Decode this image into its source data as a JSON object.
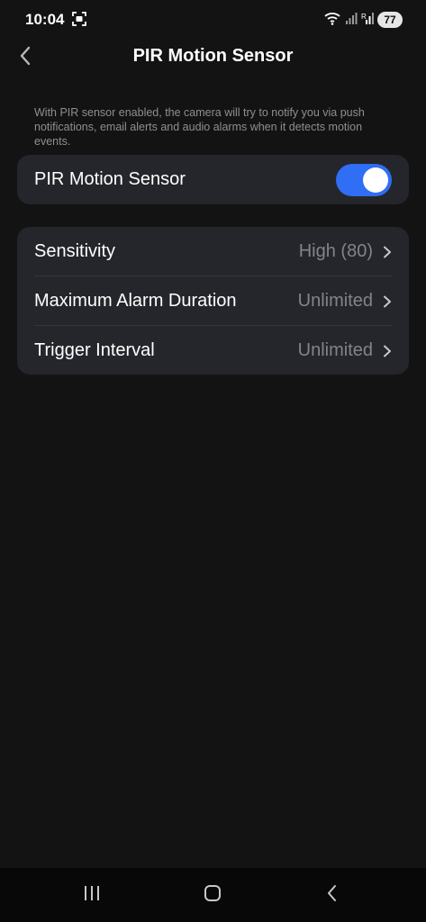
{
  "status_bar": {
    "time": "10:04",
    "battery": "77",
    "icons": [
      "screen-record-icon",
      "wifi-icon",
      "signal-icon",
      "signal-r-icon",
      "battery-icon"
    ]
  },
  "header": {
    "title": "PIR Motion Sensor",
    "back_icon": "chevron-left-icon"
  },
  "description": "With PIR sensor enabled, the camera will try to notify you via push notifications, email alerts and audio alarms when it detects motion events.",
  "pir_toggle": {
    "label": "PIR Motion Sensor",
    "enabled": true,
    "accent_color": "#2f6ef5"
  },
  "settings": [
    {
      "label": "Sensitivity",
      "value": "High (80)"
    },
    {
      "label": "Maximum Alarm Duration",
      "value": "Unlimited"
    },
    {
      "label": "Trigger Interval",
      "value": "Unlimited"
    }
  ],
  "nav_bar": {
    "icons": [
      "recent-apps-icon",
      "home-icon",
      "back-icon"
    ]
  }
}
